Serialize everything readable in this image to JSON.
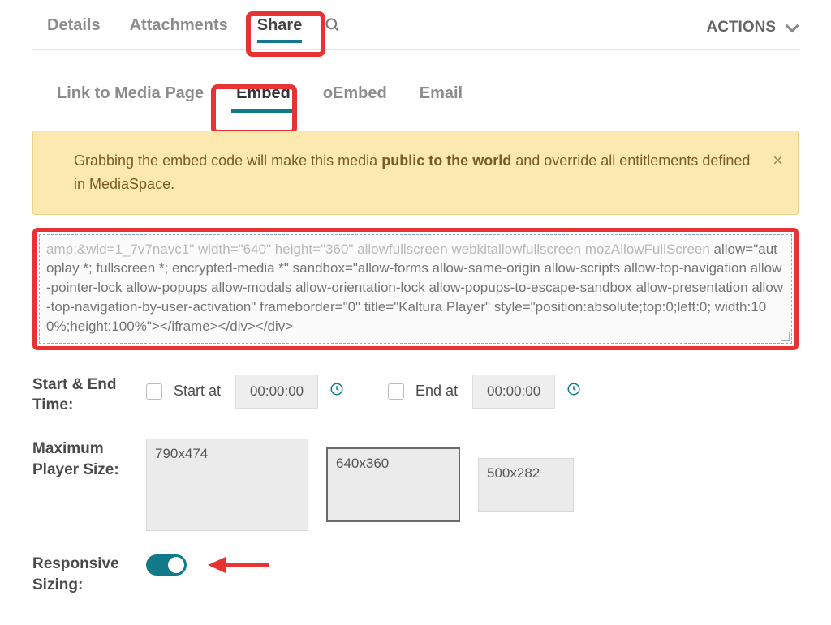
{
  "topTabs": {
    "details": "Details",
    "attachments": "Attachments",
    "share": "Share"
  },
  "actions": {
    "label": "ACTIONS"
  },
  "subTabs": {
    "link": "Link to Media Page",
    "embed": "Embed",
    "oembed": "oEmbed",
    "email": "Email"
  },
  "alert": {
    "pre": "Grabbing the embed code will make this media ",
    "bold": "public to the world",
    "post": " and override all entitlements defined in MediaSpace."
  },
  "embedCode": {
    "faded": "amp;&wid=1_7v7navc1\" width=\"640\" height=\"360\" allowfullscreen webkitallowfullscreen mozAllowFullScreen",
    "rest": " allow=\"autoplay *; fullscreen *; encrypted-media *\" sandbox=\"allow-forms allow-same-origin allow-scripts allow-top-navigation allow-pointer-lock allow-popups allow-modals allow-orientation-lock allow-popups-to-escape-sandbox allow-presentation allow-top-navigation-by-user-activation\" frameborder=\"0\" title=\"Kaltura Player\" style=\"position:absolute;top:0;left:0; width:100%;height:100%\"></iframe></div></div>"
  },
  "labels": {
    "startEnd": "Start & End Time:",
    "startAt": "Start at",
    "endAt": "End at",
    "maxSize": "Maximum Player Size:",
    "responsive": "Responsive Sizing:"
  },
  "times": {
    "start": "00:00:00",
    "end": "00:00:00"
  },
  "sizes": [
    "790x474",
    "640x360",
    "500x282"
  ],
  "selectedSizeIndex": 1,
  "responsiveOn": true
}
